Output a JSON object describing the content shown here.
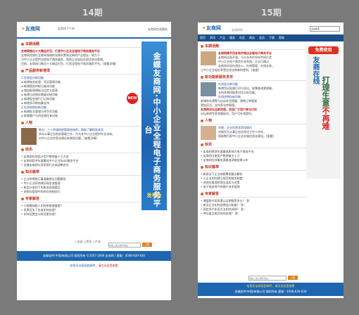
{
  "labels": {
    "left": "14期",
    "right": "15期"
  },
  "left": {
    "logo": "友商网",
    "tagline": "友商网下午茶",
    "contact": "友商网在线服务",
    "sections": [
      {
        "title": "本期话题",
        "lines": [
          {
            "text": "友商网推出十大精品栏目，打造中小企业全程电子商务服务平台",
            "style": "red"
          },
          {
            "text": "友商网凭借在互联网领域的深厚积累和全新的产品理念，致力于",
            "style": ""
          },
          {
            "text": "为中小企业提供全程电子商务服务，帮助企业轻松实现信息化管理。",
            "style": ""
          },
          {
            "text": "目前，友商网已推出十大精品栏目，打造全程电子商务服务平台。[查看详情]",
            "style": ""
          }
        ]
      },
      {
        "title": "产品服务新增项",
        "lines": [
          {
            "text": "1.在线会计新功能",
            "style": "blue"
          },
          {
            "text": "  新增账务处理、凭证管理功能",
            "style": "bullet"
          },
          {
            "text": "  新增税务申报与查询功能",
            "style": "bullet"
          },
          {
            "text": "  增加报表模板与自定义报表",
            "style": "bullet"
          },
          {
            "text": "  新增与进销存数据对接功能",
            "style": "bullet"
          },
          {
            "text": "  新增现金银行日记账功能",
            "style": "bullet"
          },
          {
            "text": "  新增多币种核算支持",
            "style": "bullet"
          },
          {
            "text": "2.在线进销存新功能",
            "style": "blue"
          },
          {
            "text": "  新增批次管理与序列号功能",
            "style": "bullet"
          },
          {
            "text": "  新增客户与供应商往来对账",
            "style": "bullet"
          }
        ]
      },
      {
        "title": "人物",
        "lines": [
          {
            "text": "陈志：三十余城财经管理咨询师，帮助了解财务状况",
            "style": "blue"
          },
          {
            "text": "  多年从事企业财务管理工作，为众多中小企业提供专业咨询。",
            "style": ""
          },
          {
            "text": "  对中小企业信息化建设有独到见解。[查看详情]",
            "style": ""
          }
        ]
      },
      {
        "title": "快讯",
        "lines": [
          {
            "text": "• 友商网在线会计用户数突破十万大关",
            "style": ""
          },
          {
            "text": "• 友商网获评年度最佳中小企业SaaS服务平台",
            "style": ""
          },
          {
            "text": "• 金蝶友商网与多家银行达成战略合作",
            "style": ""
          }
        ]
      },
      {
        "title": "知识荟萃",
        "lines": [
          {
            "text": "• 企业所得税汇算清缴常见问题解答",
            "style": ""
          },
          {
            "text": "• 中小企业如何做好现金流管理",
            "style": ""
          },
          {
            "text": "• 新会计准则下的账务处理要点",
            "style": ""
          },
          {
            "text": "• 进销存管理中的库存控制技巧",
            "style": ""
          }
        ]
      },
      {
        "title": "专家解答",
        "lines": [
          {
            "text": "• 小规模纳税人如何申报增值税？",
            "style": ""
          },
          {
            "text": "• 发票丢失了应该如何处理？",
            "style": ""
          },
          {
            "text": "• 如何设置会计科目更合理？",
            "style": ""
          }
        ]
      }
    ],
    "new_badge": "NEW",
    "banner_text": "金蝶友商网·中小企业全程电子商务服务平台",
    "banner_pub": "发布会",
    "search": {
      "options": "○全站 ○资讯 ○产品",
      "placeholder": "请输入电子邮件地址",
      "button": "订阅"
    },
    "footer": "金蝶软件(中国)有限公司 版权所有 ©2007-2009 友商网 | 客服：4008-830-830",
    "footer2": {
      "prefix": "若您无法阅读此邮件，",
      "link": "请点击这里查看"
    }
  },
  "right": {
    "logo": "友商网",
    "tagline": "友商职场",
    "select": "全站搜索",
    "nav": [
      "首页",
      "资讯",
      "产品",
      "服务",
      "社区",
      "商务",
      "会员",
      "下载",
      "帮助"
    ],
    "sections": [
      {
        "title": "本期话题",
        "lines": [
          {
            "text": "友商网携手用友软件推出全程电子商务平台",
            "style": "red"
          },
          {
            "text": "友商网全面开放，与众多合作伙伴共同打造",
            "style": ""
          },
          {
            "text": "中小企业电子商务生态系统。企业可通过",
            "style": ""
          },
          {
            "text": "友商网实现在线办公、在线管理、在线交易。",
            "style": ""
          },
          {
            "text": "让中小企业轻松享受信息化带来的便利。[查看]",
            "style": ""
          }
        ]
      },
      {
        "title": "新功能新服务发布",
        "lines": [
          {
            "text": "在线会计新功能",
            "style": "blue"
          },
          {
            "text": "  新增凭证批量打印与导出，账簿查询更便捷，",
            "style": ""
          },
          {
            "text": "  支持多期间报表对比分析功能。",
            "style": ""
          },
          {
            "text": "在线进销存新功能",
            "style": "blue"
          },
          {
            "text": "  新增库存预警与自动补货提醒，销售订单管理",
            "style": ""
          },
          {
            "text": "  更加灵活，支持多仓库管理。",
            "style": ""
          },
          {
            "text": "友商网论坛全新改版，欢迎广大用户参与讨论",
            "style": "red"
          },
          {
            "text": "  论坛新增专家答疑板块，用户可在线提问。",
            "style": ""
          }
        ]
      },
      {
        "title": "人物",
        "lines": [
          {
            "text": "刘刚：企业信息化资深顾问",
            "style": "blue"
          },
          {
            "text": "  刘刚先生从事企业信息化工作十余年，",
            "style": ""
          },
          {
            "text": "  帮助数百家中小企业实施信息化建设。[查看]",
            "style": ""
          }
        ]
      },
      {
        "title": "快讯",
        "lines": [
          {
            "text": "• 友商网荣获年度最具影响力电子商务平台",
            "style": ""
          },
          {
            "text": "• 友商网注册用户数突破五十万",
            "style": ""
          },
          {
            "text": "• 友商网在线服务满意度调查结果公布",
            "style": ""
          }
        ]
      },
      {
        "title": "知识荟萃",
        "lines": [
          {
            "text": "• 新税法下企业纳税筹划要点解析",
            "style": ""
          },
          {
            "text": "• 小企业如何建立规范的财务制度",
            "style": ""
          },
          {
            "text": "• 进销存管理的常见误区与对策",
            "style": ""
          },
          {
            "text": "• 电子商务时代的客户关系管理",
            "style": ""
          }
        ]
      },
      {
        "title": "专家解答",
        "lines": [
          {
            "text": "• 增值税专用发票认证期限是多久？   答：",
            "style": ""
          },
          {
            "text": "• 新设企业如何选择会计制度？   答：",
            "style": ""
          },
          {
            "text": "• 固定资产折旧方法如何选择？   答：",
            "style": ""
          },
          {
            "text": "• 库存盘点差异如何处理？   答：",
            "style": ""
          }
        ]
      }
    ],
    "ad_free": "免费使用",
    "ad_vt1": "友商在线",
    "ad_vt2a": "打理",
    "ad_vt2b": "生意",
    "ad_vt2c": "不再难",
    "search": {
      "placeholder": "请输入电子邮件地址",
      "button": "订阅"
    },
    "footer": {
      "line1": "若您无法阅读此邮件，请点击这里查看",
      "line2": "金蝶软件(中国)有限公司 版权所有 客服：4008-830-830"
    }
  }
}
